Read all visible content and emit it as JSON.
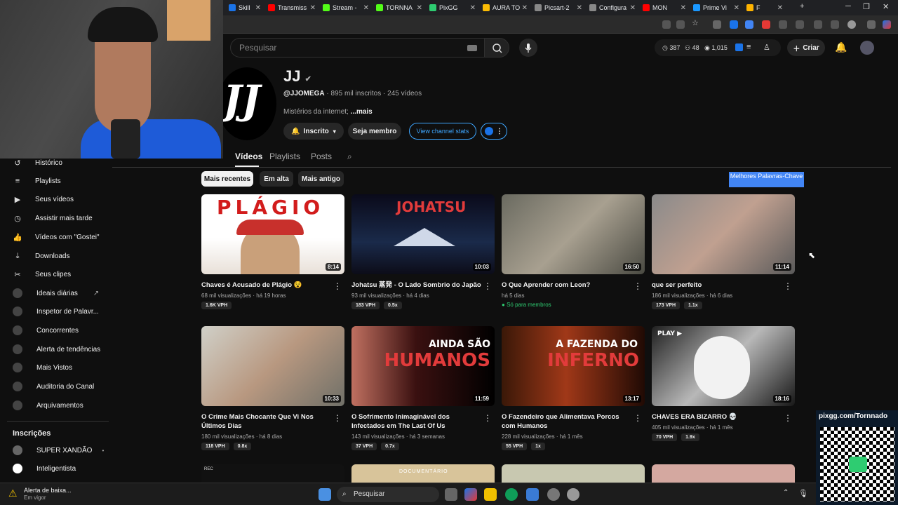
{
  "browser": {
    "tabs": [
      {
        "label": "Skill",
        "color": "#1a73e8"
      },
      {
        "label": "Transmiss",
        "color": "#ff0000"
      },
      {
        "label": "Stream -",
        "color": "#53fc18"
      },
      {
        "label": "TORNNA",
        "color": "#53fc18"
      },
      {
        "label": "PixGG",
        "color": "#2ecc71"
      },
      {
        "label": "AURA TO",
        "color": "#fbbc04"
      },
      {
        "label": "Picsart-2",
        "color": "#888888"
      },
      {
        "label": "Configura",
        "color": "#888888"
      },
      {
        "label": "MON",
        "color": "#ff0000"
      },
      {
        "label": "Prime Vi",
        "color": "#1a98ff"
      },
      {
        "label": "F",
        "color": "#ffb400"
      }
    ]
  },
  "header": {
    "search_placeholder": "Pesquisar",
    "stat_views": "387",
    "stat_subs": "48",
    "stat_total": "1,015",
    "create_label": "Criar"
  },
  "channel": {
    "name": "JJ",
    "handle": "@JJOMEGA",
    "subs": "895 mil inscritos",
    "videos_count": "245 vídeos",
    "description": "Mistérios da internet;",
    "more": "...mais",
    "subscribed_label": "Inscrito",
    "join_label": "Seja membro",
    "stats_label": "View channel stats",
    "tabs": [
      "Vídeos",
      "Playlists",
      "Posts"
    ],
    "chips": [
      "Mais recentes",
      "Em alta",
      "Mais antigo"
    ],
    "keywords_button": "Melhores Palavras-Chave"
  },
  "sidebar": {
    "items": [
      {
        "label": "Histórico",
        "icon": "history-icon"
      },
      {
        "label": "Playlists",
        "icon": "playlist-icon"
      },
      {
        "label": "Seus vídeos",
        "icon": "your-videos-icon"
      },
      {
        "label": "Assistir mais tarde",
        "icon": "clock-icon"
      },
      {
        "label": "Vídeos com \"Gostei\"",
        "icon": "thumbs-up-icon"
      },
      {
        "label": "Downloads",
        "icon": "download-icon"
      },
      {
        "label": "Seus clipes",
        "icon": "scissors-icon"
      },
      {
        "label": "Ideais diárias",
        "icon": "vidiq-icon"
      },
      {
        "label": "Inspetor de Palavr...",
        "icon": "vidiq-icon"
      },
      {
        "label": "Concorrentes",
        "icon": "vidiq-icon"
      },
      {
        "label": "Alerta de tendências",
        "icon": "vidiq-icon"
      },
      {
        "label": "Mais Vistos",
        "icon": "vidiq-icon"
      },
      {
        "label": "Auditoria do Canal",
        "icon": "vidiq-icon"
      },
      {
        "label": "Arquivamentos",
        "icon": "vidiq-icon"
      }
    ],
    "subscriptions_title": "Inscrições",
    "subscriptions": [
      "SUPER XANDÃO",
      "Inteligentista"
    ]
  },
  "videos": [
    {
      "title": "Chaves é Acusado de Plágio 😵",
      "views": "68 mil visualizações",
      "age": "há 19 horas",
      "duration": "8:14",
      "vph": "1.6K VPH",
      "mult": ""
    },
    {
      "title": "Johatsu 蒸発 - O Lado Sombrio do Japão",
      "views": "93 mil visualizações",
      "age": "há 4 dias",
      "duration": "10:03",
      "vph": "183 VPH",
      "mult": "0.5x"
    },
    {
      "title": "O Que Aprender com Leon?",
      "views": "",
      "age": "há 5 dias",
      "duration": "16:50",
      "vph": "",
      "mult": "",
      "members": "Só para membros"
    },
    {
      "title": "que ser perfeito",
      "views": "186 mil visualizações",
      "age": "há 6 dias",
      "duration": "11:14",
      "vph": "173 VPH",
      "mult": "1.1x"
    },
    {
      "title": "O Crime Mais Chocante Que Vi Nos Últimos Dias",
      "views": "180 mil visualizações",
      "age": "há 8 dias",
      "duration": "10:33",
      "vph": "118 VPH",
      "mult": "0.8x"
    },
    {
      "title": "O Sofrimento Inimaginável dos Infectados em The Last Of Us",
      "views": "143 mil visualizações",
      "age": "há 3 semanas",
      "duration": "11:59",
      "vph": "37 VPH",
      "mult": "0.7x"
    },
    {
      "title": "O Fazendeiro que Alimentava Porcos com Humanos",
      "views": "228 mil visualizações",
      "age": "há 1 mês",
      "duration": "13:17",
      "vph": "55 VPH",
      "mult": "1x"
    },
    {
      "title": "CHAVES ERA BIZARRO 💀",
      "views": "405 mil visualizações",
      "age": "há 1 mês",
      "duration": "18:16",
      "vph": "70 VPH",
      "mult": "1.9x"
    }
  ],
  "thumb_text": {
    "plagio": "PLÁGIO",
    "johatsu": "JOHATSU",
    "ainda": "AINDA SÃO",
    "humanos": "HUMANOS",
    "fazenda": "A FAZENDA DO",
    "inferno": "INFERNO",
    "play": "PLAY ▶",
    "doc": "DOCUMENTÁRIO",
    "rec": "REC"
  },
  "taskbar": {
    "alert_title": "Alerta de baixa...",
    "alert_sub": "Em vigor",
    "search": "Pesquisar"
  },
  "overlay": {
    "qr_label": "pixgg.com/Tornnado"
  },
  "colors": {
    "accent_blue": "#3ea6ff",
    "keywords_bg": "#4285f4",
    "brand_red": "#ff0000"
  }
}
